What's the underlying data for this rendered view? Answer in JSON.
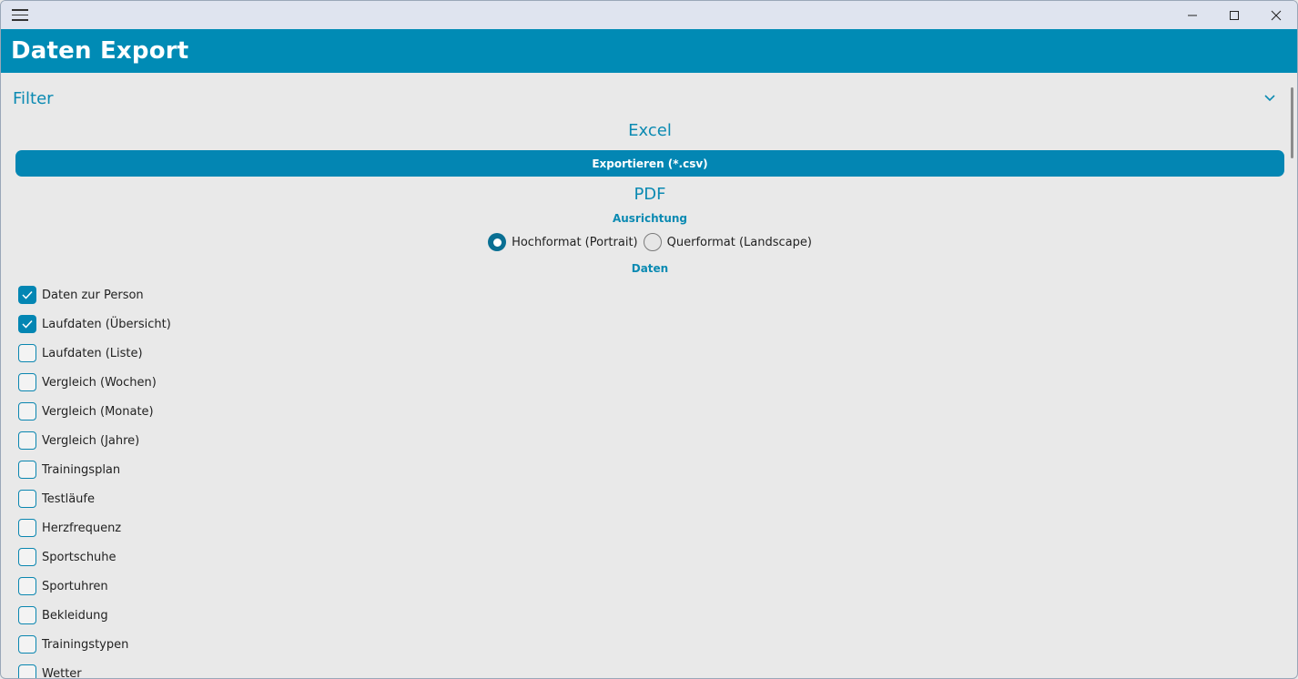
{
  "window": {
    "menu_icon": "hamburger-icon",
    "controls": [
      "minimize-icon",
      "maximize-icon",
      "close-icon"
    ]
  },
  "header": {
    "title": "Daten Export"
  },
  "filter": {
    "label": "Filter",
    "icon": "chevron-down-icon"
  },
  "excel": {
    "title": "Excel",
    "export_button": "Exportieren (*.csv)"
  },
  "pdf": {
    "title": "PDF",
    "orientation_label": "Ausrichtung",
    "orientation_options": [
      {
        "label": "Hochformat (Portrait)",
        "selected": true
      },
      {
        "label": "Querformat (Landscape)",
        "selected": false
      }
    ],
    "data_label": "Daten",
    "items": [
      {
        "label": "Daten zur Person",
        "checked": true
      },
      {
        "label": "Laufdaten (Übersicht)",
        "checked": true
      },
      {
        "label": "Laufdaten (Liste)",
        "checked": false
      },
      {
        "label": "Vergleich (Wochen)",
        "checked": false
      },
      {
        "label": "Vergleich (Monate)",
        "checked": false
      },
      {
        "label": "Vergleich (Jahre)",
        "checked": false
      },
      {
        "label": "Trainingsplan",
        "checked": false
      },
      {
        "label": "Testläufe",
        "checked": false
      },
      {
        "label": "Herzfrequenz",
        "checked": false
      },
      {
        "label": "Sportschuhe",
        "checked": false
      },
      {
        "label": "Sportuhren",
        "checked": false
      },
      {
        "label": "Bekleidung",
        "checked": false
      },
      {
        "label": "Trainingstypen",
        "checked": false
      },
      {
        "label": "Wetter",
        "checked": false
      }
    ]
  },
  "colors": {
    "accent": "#008bb5",
    "header_bg": "#008bb5",
    "background": "#e9e9e9"
  }
}
